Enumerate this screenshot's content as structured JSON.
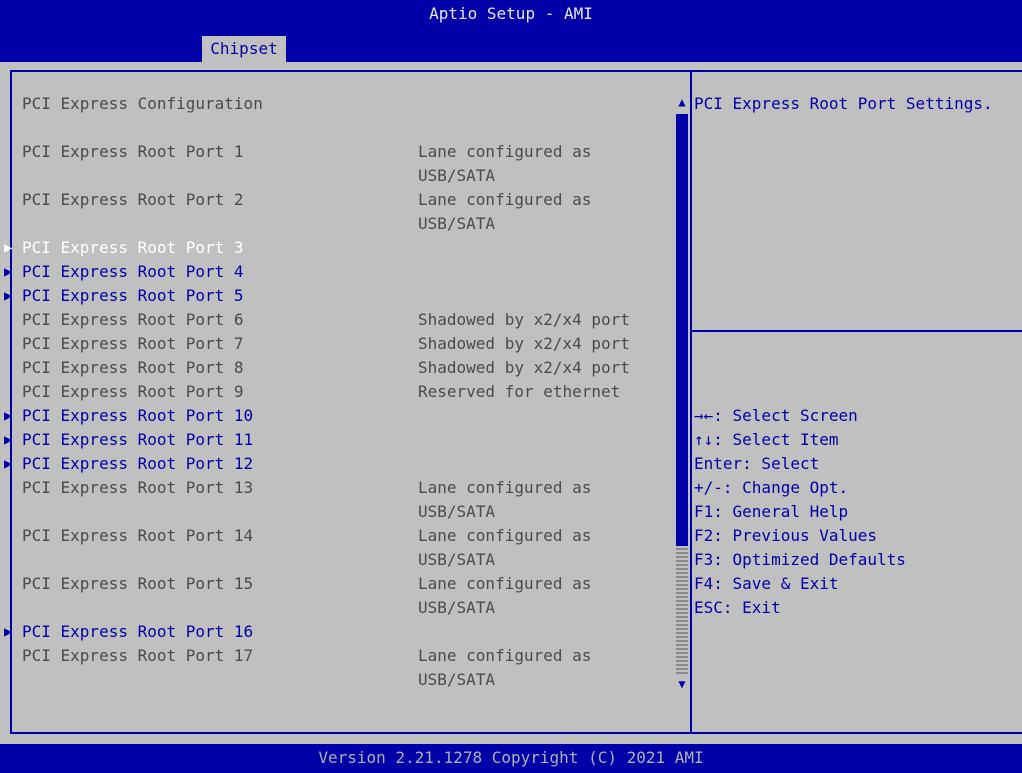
{
  "header": {
    "title": "Aptio Setup - AMI",
    "active_tab": "Chipset"
  },
  "colors": {
    "background_blue": "#0000a8",
    "panel_gray": "#c0c0c0",
    "text_gray": "#4a4a4a",
    "selected_white": "#ffffff"
  },
  "section_title": "PCI Express Configuration",
  "items": [
    {
      "label": "PCI Express Root Port 1",
      "value": "Lane configured as",
      "value2": "USB/SATA",
      "submenu": false,
      "selected": false
    },
    {
      "label": "PCI Express Root Port 2",
      "value": "Lane configured as",
      "value2": "USB/SATA",
      "submenu": false,
      "selected": false
    },
    {
      "label": "PCI Express Root Port 3",
      "value": "",
      "value2": "",
      "submenu": true,
      "selected": true
    },
    {
      "label": "PCI Express Root Port 4",
      "value": "",
      "value2": "",
      "submenu": true,
      "selected": false
    },
    {
      "label": "PCI Express Root Port 5",
      "value": "",
      "value2": "",
      "submenu": true,
      "selected": false
    },
    {
      "label": "PCI Express Root Port 6",
      "value": "Shadowed by x2/x4 port",
      "value2": "",
      "submenu": false,
      "selected": false
    },
    {
      "label": "PCI Express Root Port 7",
      "value": "Shadowed by x2/x4 port",
      "value2": "",
      "submenu": false,
      "selected": false
    },
    {
      "label": "PCI Express Root Port 8",
      "value": "Shadowed by x2/x4 port",
      "value2": "",
      "submenu": false,
      "selected": false
    },
    {
      "label": "PCI Express Root Port 9",
      "value": "Reserved for ethernet",
      "value2": "",
      "submenu": false,
      "selected": false
    },
    {
      "label": "PCI Express Root Port 10",
      "value": "",
      "value2": "",
      "submenu": true,
      "selected": false
    },
    {
      "label": "PCI Express Root Port 11",
      "value": "",
      "value2": "",
      "submenu": true,
      "selected": false
    },
    {
      "label": "PCI Express Root Port 12",
      "value": "",
      "value2": "",
      "submenu": true,
      "selected": false
    },
    {
      "label": "PCI Express Root Port 13",
      "value": "Lane configured as",
      "value2": "USB/SATA",
      "submenu": false,
      "selected": false
    },
    {
      "label": "PCI Express Root Port 14",
      "value": "Lane configured as",
      "value2": "USB/SATA",
      "submenu": false,
      "selected": false
    },
    {
      "label": "PCI Express Root Port 15",
      "value": "Lane configured as",
      "value2": "USB/SATA",
      "submenu": false,
      "selected": false
    },
    {
      "label": "PCI Express Root Port 16",
      "value": "",
      "value2": "",
      "submenu": true,
      "selected": false
    },
    {
      "label": "PCI Express Root Port 17",
      "value": "Lane configured as",
      "value2": "USB/SATA",
      "submenu": false,
      "selected": false
    }
  ],
  "help": {
    "description": "PCI Express Root Port Settings.",
    "keys": [
      "→←: Select Screen",
      "↑↓: Select Item",
      "Enter: Select",
      "+/-: Change Opt.",
      "F1: General Help",
      "F2: Previous Values",
      "F3: Optimized Defaults",
      "F4: Save & Exit",
      "ESC: Exit"
    ]
  },
  "scrollbar": {
    "up_icon": "▲",
    "down_icon": "▼"
  },
  "footer": {
    "version": "Version 2.21.1278 Copyright (C) 2021 AMI"
  }
}
